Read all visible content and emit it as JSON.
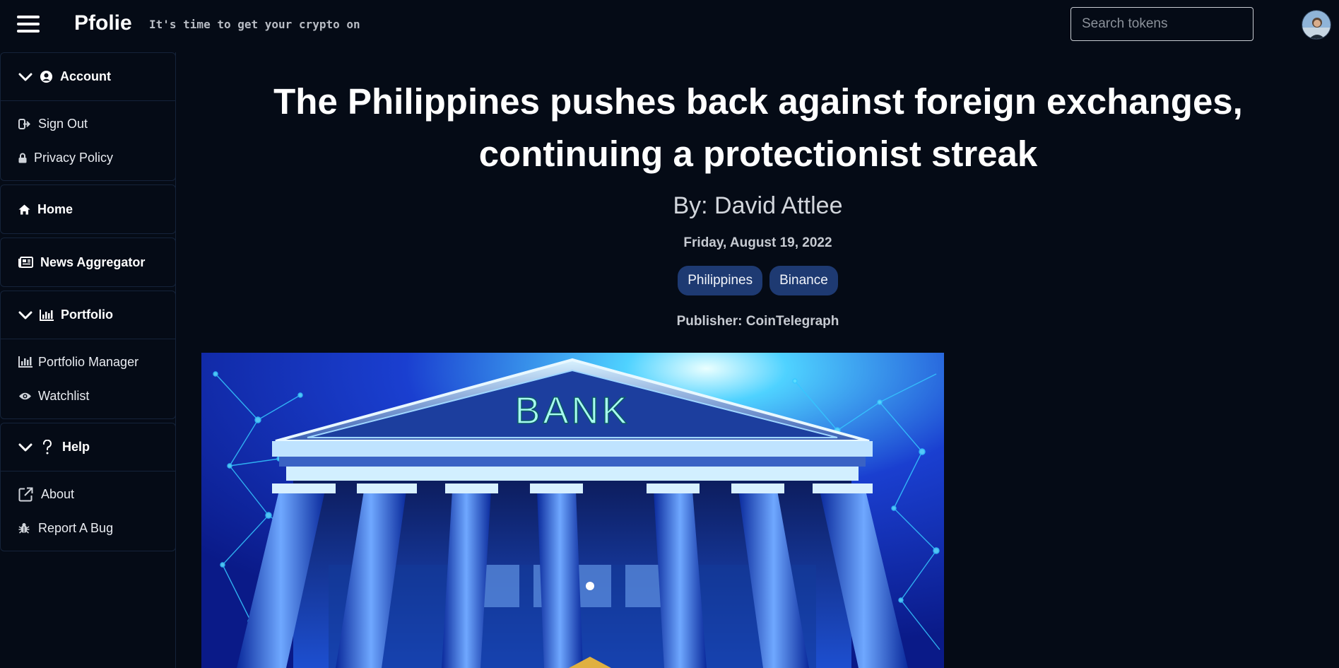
{
  "header": {
    "brand": "Pfolie",
    "tagline": "It's time to get your crypto on",
    "search_placeholder": "Search tokens"
  },
  "sidebar": {
    "account": {
      "label": "Account",
      "items": [
        {
          "label": "Sign Out",
          "icon": "sign-out-icon"
        },
        {
          "label": "Privacy Policy",
          "icon": "lock-icon"
        }
      ]
    },
    "home": {
      "label": "Home",
      "icon": "home-icon"
    },
    "news": {
      "label": "News Aggregator",
      "icon": "newspaper-icon"
    },
    "portfolio": {
      "label": "Portfolio",
      "items": [
        {
          "label": "Portfolio Manager",
          "icon": "bar-chart-icon"
        },
        {
          "label": "Watchlist",
          "icon": "eye-icon"
        }
      ]
    },
    "help": {
      "label": "Help",
      "items": [
        {
          "label": "About",
          "icon": "external-link-icon"
        },
        {
          "label": "Report A Bug",
          "icon": "bug-icon"
        }
      ]
    }
  },
  "article": {
    "title": "The Philippines pushes back against foreign exchanges, continuing a protectionist streak",
    "byline": "By: David Attlee",
    "date": "Friday, August 19, 2022",
    "tags": [
      "Philippines",
      "Binance"
    ],
    "publisher": "Publisher: CoinTelegraph",
    "hero_sign": "BANK"
  },
  "colors": {
    "background": "#050b16",
    "border": "#15233a",
    "tag": "#1e3a72"
  }
}
